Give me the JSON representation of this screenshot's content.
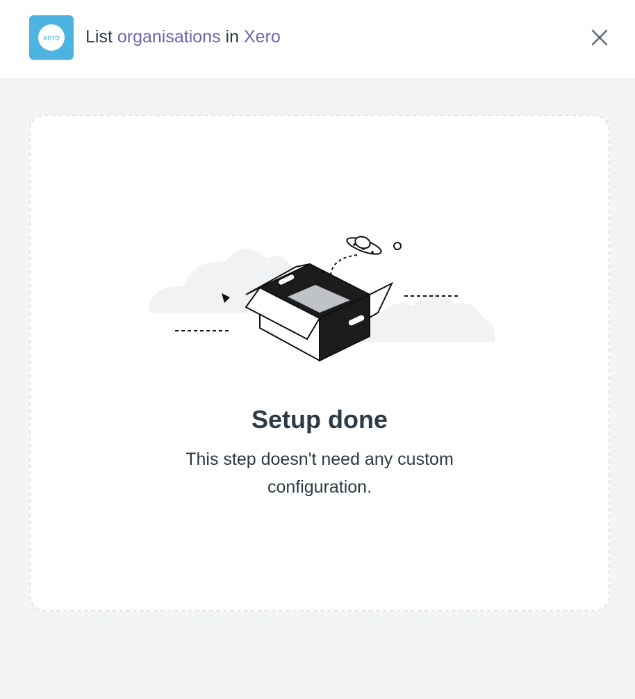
{
  "header": {
    "app_logo_text": "xero",
    "title_prefix": "List",
    "title_link_action": "organisations",
    "title_middle": "in",
    "title_link_app": "Xero",
    "close_icon": "close-icon"
  },
  "empty_state": {
    "illustration": "open-box-illustration",
    "heading": "Setup done",
    "description": "This step doesn't need any custom configuration."
  },
  "colors": {
    "brand": "#4db3e0",
    "link": "#6a67b0",
    "text": "#2b3a44",
    "background": "#f3f4f6"
  }
}
